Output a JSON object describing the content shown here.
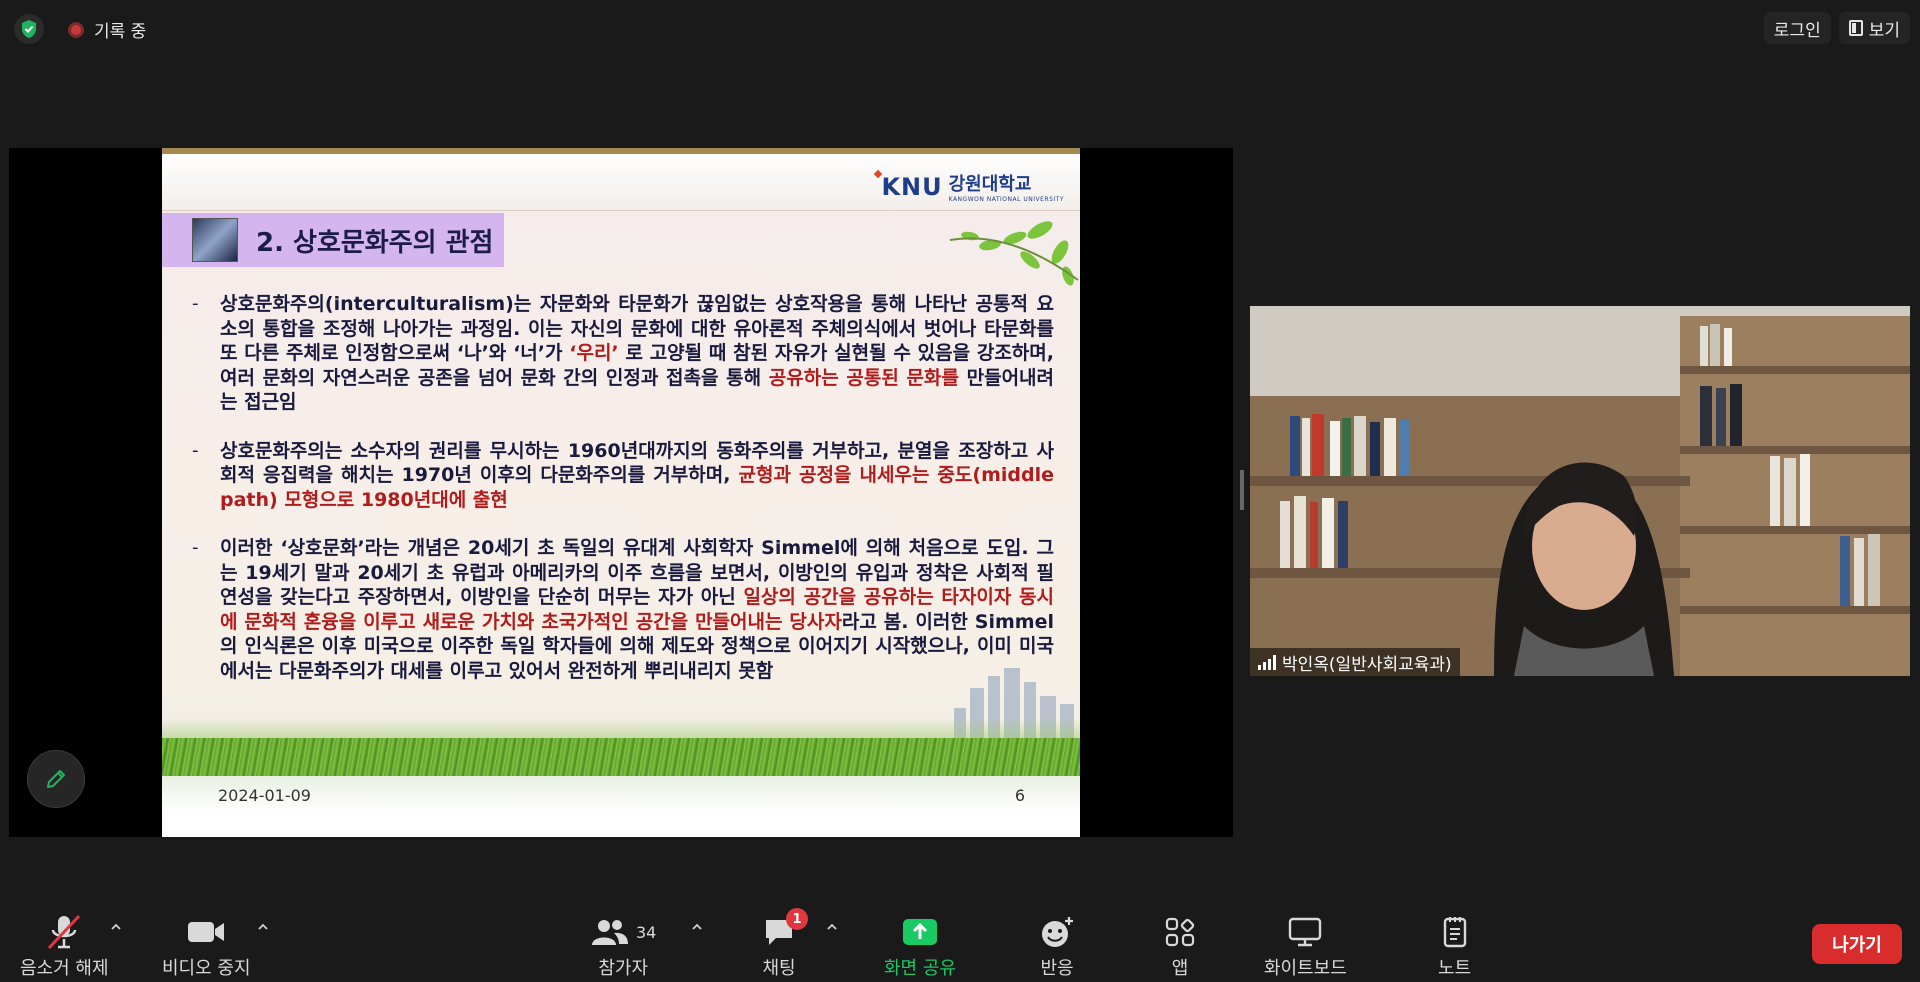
{
  "topbar": {
    "recording_label": "기록 중",
    "login_label": "로그인",
    "view_label": "보기"
  },
  "slide": {
    "logo_mark": "KNU",
    "logo_ko": "강원대학교",
    "logo_en": "KANGWON NATIONAL UNIVERSITY",
    "title": "2. 상호문화주의 관점",
    "bullet_dash": "-",
    "bullet1_a": "상호문화주의(interculturalism)는 자문화와 타문화가 끊임없는 상호작용을 통해 나타난 공통적 요소의 통합을 조정해 나아가는 과정임. 이는 자신의 문화에 대한 유아론적 주체의식에서 벗어나 타문화를 또 다른 주체로 인정함으로써 ‘나’와 ‘너’가 ",
    "bullet1_hl1": "‘우리’",
    "bullet1_b": " 로 고양될 때 참된 자유가 실현될 수 있음을 강조하며, 여러 문화의 자연스러운 공존을 넘어 문화 간의 인정과 접촉을 통해 ",
    "bullet1_hl2": "공유하는 공통된 문화를",
    "bullet1_c": " 만들어내려는 접근임",
    "bullet2_a": "상호문화주의는 소수자의 권리를 무시하는 1960년대까지의 동화주의를 거부하고, 분열을 조장하고 사회적 응집력을 해치는 1970년 이후의 다문화주의를 거부하며, ",
    "bullet2_hl": "균형과 공정을 내세우는 중도(middle path) 모형으로 1980년대에 출현",
    "bullet3_a": "이러한 ‘상호문화’라는 개념은 20세기 초 독일의 유대계 사회학자 Simmel에 의해 처음으로 도입. 그는 19세기 말과 20세기 초 유럽과 아메리카의 이주 흐름을 보면서, 이방인의 유입과 정착은 사회적 필연성을 갖는다고 주장하면서, 이방인을 단순히 머무는 자가 아닌 ",
    "bullet3_hl": "일상의 공간을 공유하는 타자이자 동시에 문화적 혼융을 이루고 새로운 가치와 초국가적인 공간을 만들어내는 당사자",
    "bullet3_b": "라고 봄. 이러한 Simmel의 인식론은 이후 미국으로 이주한 독일 학자들에 의해 제도와 정책으로 이어지기 시작했으나, 이미 미국에서는 다문화주의가 대세를 이루고 있어서 완전하게 뿌리내리지 못함",
    "date": "2024-01-09",
    "page": "6"
  },
  "video": {
    "name": "박인옥(일반사회교육과)"
  },
  "toolbar": {
    "unmute": "음소거 해제",
    "stop_video": "비디오 중지",
    "participants": "참가자",
    "participants_count": "34",
    "chat": "채팅",
    "chat_badge": "1",
    "share": "화면 공유",
    "reactions": "반응",
    "apps": "앱",
    "whiteboard": "화이트보드",
    "notes": "노트",
    "leave": "나가기"
  },
  "colors": {
    "highlight": "#b01c1c",
    "share_green": "#18c964",
    "leave_red": "#d92d2d",
    "title_bg": "#d5b5ee"
  }
}
